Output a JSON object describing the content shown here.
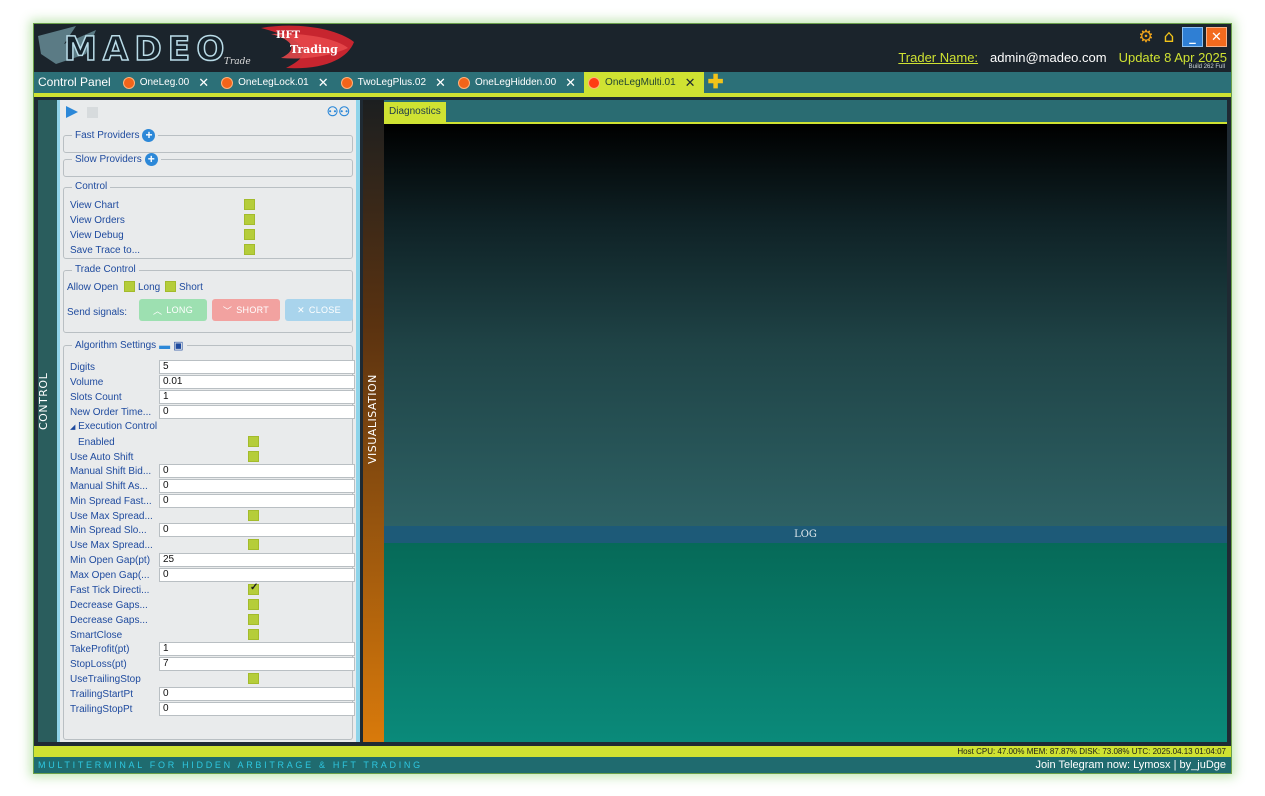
{
  "header": {
    "logo": {
      "main": "MADEO",
      "hft": "HFT",
      "trading": "Trading",
      "trade": "Trade"
    },
    "trader_label": "Trader Name:",
    "trader_value": "admin@madeo.com",
    "update_label": "Update 8 Apr 2025",
    "build_label": "Build 262 Full",
    "icons": [
      "gear-icon",
      "home-icon",
      "minimize-icon",
      "close-icon"
    ]
  },
  "tabs": {
    "control_panel_label": "Control Panel",
    "items": [
      {
        "label": "OneLeg.00",
        "active": false
      },
      {
        "label": "OneLegLock.01",
        "active": false
      },
      {
        "label": "TwoLegPlus.02",
        "active": false
      },
      {
        "label": "OneLegHidden.00",
        "active": false
      },
      {
        "label": "OneLegMulti.01",
        "active": true
      }
    ],
    "close_glyph": "✕",
    "add_glyph": "✚"
  },
  "strips": {
    "control": "CONTROL",
    "visualisation": "VISUALISATION"
  },
  "panel": {
    "fast_providers": "Fast Providers",
    "slow_providers": "Slow Providers",
    "control_group": {
      "title": "Control",
      "items": [
        "View Chart",
        "View Orders",
        "View Debug",
        "Save Trace to..."
      ]
    },
    "trade_control": {
      "title": "Trade Control",
      "allow_open": "Allow Open",
      "long": "Long",
      "short": "Short",
      "send_signals": "Send signals:",
      "long_button": "LONG",
      "short_button": "SHORT",
      "close_button": "CLOSE"
    },
    "algorithm": {
      "title": "Algorithm Settings",
      "digits_label": "Digits",
      "digits_value": "5",
      "volume_label": "Volume",
      "volume_value": "0.01",
      "slots_label": "Slots Count",
      "slots_value": "1",
      "new_order_label": "New Order Time...",
      "new_order_value": "0",
      "exec_control": "Execution Control",
      "enabled_label": "Enabled",
      "auto_shift_label": "Use Auto Shift",
      "manual_bid_label": "Manual Shift Bid...",
      "manual_bid_value": "0",
      "manual_ask_label": "Manual Shift As...",
      "manual_ask_value": "0",
      "min_spread_fast_label": "Min Spread Fast...",
      "min_spread_fast_value": "0",
      "use_max_spread1_label": "Use Max Spread...",
      "min_spread_slow_label": "Min Spread Slo...",
      "min_spread_slow_value": "0",
      "use_max_spread2_label": "Use Max Spread...",
      "min_open_gap_label": "Min Open Gap(pt)",
      "min_open_gap_value": "25",
      "max_open_gap_label": "Max Open Gap(...",
      "max_open_gap_value": "0",
      "fast_tick_label": "Fast Tick Directi...",
      "decrease_gaps1_label": "Decrease Gaps...",
      "decrease_gaps2_label": "Decrease Gaps...",
      "smart_close_label": "SmartClose",
      "take_profit_label": "TakeProfit(pt)",
      "take_profit_value": "1",
      "stop_loss_label": "StopLoss(pt)",
      "stop_loss_value": "7",
      "use_trailing_label": "UseTrailingStop",
      "trailing_start_label": "TrailingStartPt",
      "trailing_start_value": "0",
      "trailing_stop_label": "TrailingStopPt",
      "trailing_stop_value": "0"
    }
  },
  "main": {
    "diagnostics_tab": "Diagnostics",
    "log_label": "LOG"
  },
  "status_bar": "Host CPU: 47.00% MEM: 87.87% DISK: 73.08%  UTC: 2025.04.13 01:04:07",
  "footer": {
    "tagline": "MULTITERMINAL FOR HIDDEN ARBITRAGE & HFT TRADING",
    "telegram": "Join Telegram now: Lymosx | by_juDge"
  }
}
